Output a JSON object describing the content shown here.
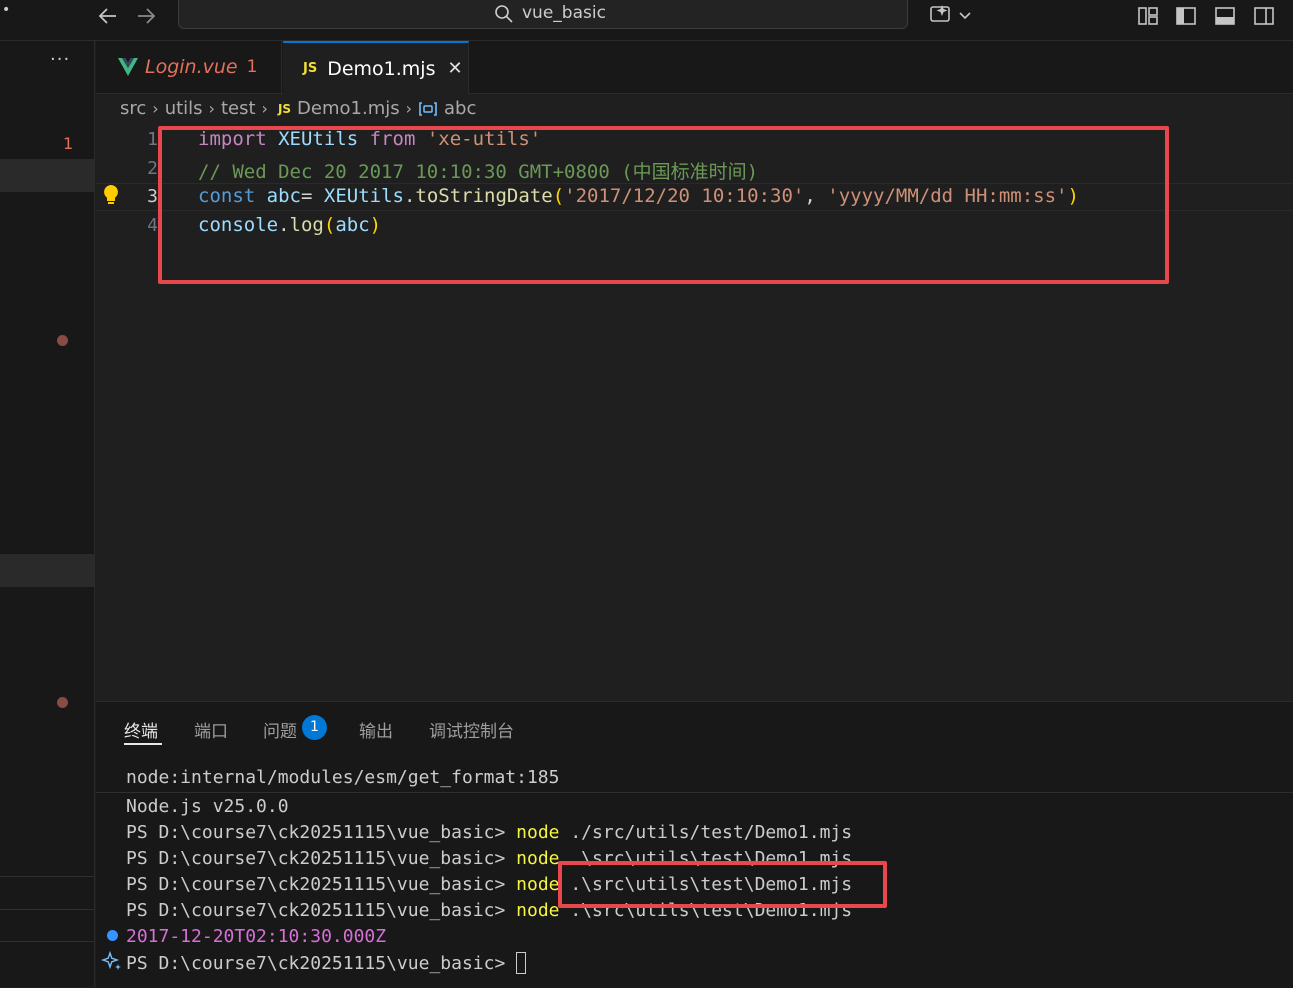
{
  "titlebar": {
    "search_text": "vue_basic"
  },
  "tabs": [
    {
      "icon": "vue-icon",
      "label": "Login.vue",
      "problems": "1"
    },
    {
      "icon": "js-icon",
      "icon_text": "JS",
      "label": "Demo1.mjs",
      "close": "✕"
    }
  ],
  "sidebar": {
    "overflow": "···",
    "problem_count": "1"
  },
  "breadcrumb": {
    "items": [
      "src",
      "utils",
      "test",
      "Demo1.mjs",
      "abc"
    ],
    "js_icon_text": "JS"
  },
  "editor": {
    "line_numbers": [
      "1",
      "2",
      "3",
      "4"
    ],
    "line1": {
      "kw": "import",
      "ident": "XEUtils",
      "from": "from",
      "str": "'xe-utils'"
    },
    "line2": {
      "comment": "// Wed Dec 20 2017 10:10:30 GMT+0800 (中国标准时间)"
    },
    "line3": {
      "kw": "const",
      "var": "abc",
      "eq": "=",
      "obj": "XEUtils",
      "dot": ".",
      "fn": "toStringDate",
      "open": "(",
      "arg1": "'2017/12/20 10:10:30'",
      "comma": ",",
      "arg2": "'yyyy/MM/dd HH:mm:ss'",
      "close": ")"
    },
    "line4": {
      "obj": "console",
      "dot": ".",
      "fn": "log",
      "open": "(",
      "arg": "abc",
      "close": ")"
    }
  },
  "panel": {
    "tabs": [
      "终端",
      "端口",
      "问题",
      "输出",
      "调试控制台"
    ],
    "problems_badge": "1"
  },
  "terminal": {
    "line0": "node:internal/modules/esm/get_format:185",
    "line1": "Node.js v25.0.0",
    "prompt": "PS D:\\course7\\ck20251115\\vue_basic>",
    "cmd": "node",
    "args": [
      "./src/utils/test/Demo1.mjs",
      ".\\src\\utils\\test\\Demo1.mjs",
      ".\\src\\utils\\test\\Demo1.mjs",
      ".\\src\\utils\\test\\Demo1.mjs"
    ],
    "output": "2017-12-20T02:10:30.000Z"
  },
  "colors": {
    "accent": "#0078d4",
    "highlight_box": "#e8484d",
    "vue_green": "#41b883"
  }
}
